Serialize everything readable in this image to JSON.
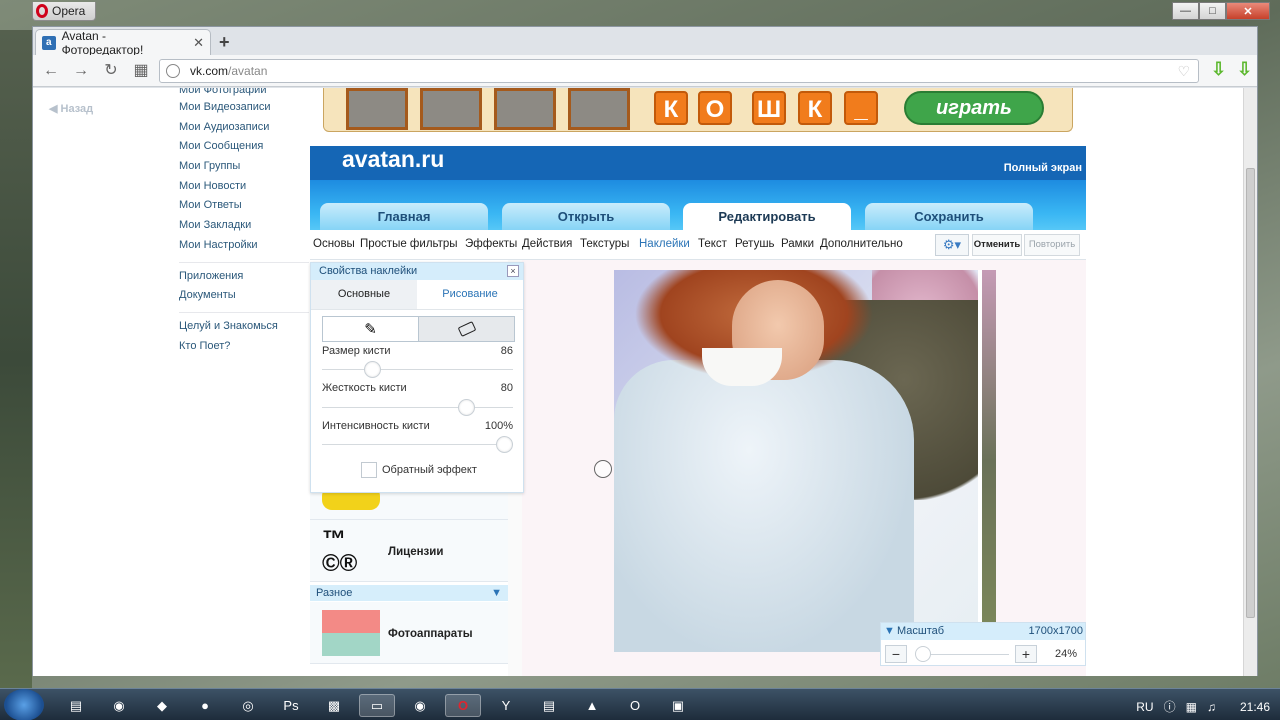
{
  "browser": {
    "app_name": "Opera",
    "tab_title": "Avatan - Фоторедактор!",
    "new_tab": "+",
    "url_host": "vk.com",
    "url_path": "/avatan"
  },
  "vk": {
    "back_label": "Назад",
    "menu": [
      "Мои Фотографии",
      "Мои Видеозаписи",
      "Мои Аудиозаписи",
      "Мои Сообщения",
      "Мои Группы",
      "Мои Новости",
      "Мои Ответы",
      "Мои Закладки",
      "Мои Настройки"
    ],
    "menu2": [
      "Приложения",
      "Документы"
    ],
    "menu3": [
      "Целуй и Знакомься",
      "Кто Поет?"
    ]
  },
  "ad": {
    "letters": [
      "К",
      "О",
      "Ш",
      "К",
      "_"
    ],
    "play_label": "играть"
  },
  "app": {
    "title": "avatan.ru",
    "fullscreen": "Полный экран",
    "main_tabs": [
      "Главная",
      "Открыть",
      "Редактировать",
      "Сохранить"
    ],
    "active_main_tab": "Редактировать",
    "sub_tabs": [
      "Основы",
      "Простые фильтры",
      "Эффекты",
      "Действия",
      "Текстуры",
      "Наклейки",
      "Текст",
      "Ретушь",
      "Рамки",
      "Дополнительно"
    ],
    "active_sub_tab": "Наклейки",
    "undo": "Отменить",
    "redo": "Повторить",
    "accent_color": "#2b74b6"
  },
  "props": {
    "title": "Свойства наклейки",
    "close": "×",
    "tabs": [
      "Основные",
      "Рисование"
    ],
    "active_tab": "Рисование",
    "brush_size_label": "Размер кисти",
    "brush_size_value": "86",
    "hardness_label": "Жесткость кисти",
    "hardness_value": "80",
    "intensity_label": "Интенсивность кисти",
    "intensity_value": "100%",
    "invert_label": "Обратный эффект",
    "invert_checked": false,
    "sliders": {
      "brush_size": 0.24,
      "hardness": 0.78,
      "intensity": 1.0
    }
  },
  "stickers": {
    "license_label": "Лицензии",
    "section_label": "Разное",
    "cameras_label": "Фотоаппараты"
  },
  "zoom": {
    "title": "Масштаб",
    "size": "1700x1700",
    "percent": "24%",
    "minus": "−",
    "plus": "+"
  },
  "taskbar": {
    "lang": "RU",
    "time": "21:46"
  }
}
